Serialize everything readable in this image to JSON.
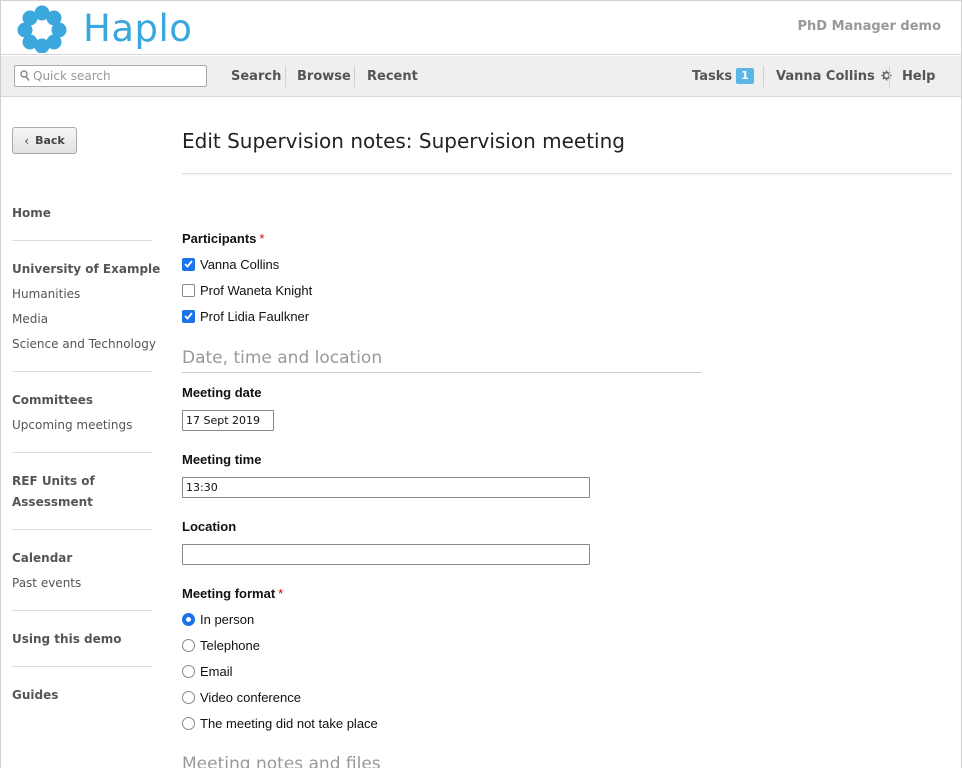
{
  "header": {
    "logo_text": "Haplo",
    "app_name": "PhD Manager demo",
    "logo_color": "#3aa7dd"
  },
  "navbar": {
    "search_placeholder": "Quick search",
    "search_value": "",
    "search": "Search",
    "browse": "Browse",
    "recent": "Recent",
    "tasks": "Tasks",
    "tasks_count": "1",
    "user": "Vanna Collins",
    "help": "Help"
  },
  "sidebar": {
    "back": "Back",
    "home": "Home",
    "university": "University of Example",
    "humanities": "Humanities",
    "media": "Media",
    "science": "Science and Technology",
    "committees": "Committees",
    "upcoming": "Upcoming meetings",
    "ref_line1": "REF Units of",
    "ref_line2": "Assessment",
    "calendar": "Calendar",
    "past_events": "Past events",
    "using_demo": "Using this demo",
    "guides": "Guides"
  },
  "main": {
    "title": "Edit Supervision notes: Supervision meeting",
    "participants_label": "Participants",
    "required_mark": "*",
    "participants": [
      {
        "label": "Vanna Collins",
        "checked": true
      },
      {
        "label": "Prof Waneta Knight",
        "checked": false
      },
      {
        "label": "Prof Lidia Faulkner",
        "checked": true
      }
    ],
    "section_date": "Date, time and location",
    "meeting_date_label": "Meeting date",
    "meeting_date_value": "17 Sept 2019",
    "meeting_time_label": "Meeting time",
    "meeting_time_value": "13:30",
    "location_label": "Location",
    "location_value": "",
    "meeting_format_label": "Meeting format",
    "formats": [
      {
        "label": "In person",
        "selected": true
      },
      {
        "label": "Telephone",
        "selected": false
      },
      {
        "label": "Email",
        "selected": false
      },
      {
        "label": "Video conference",
        "selected": false
      },
      {
        "label": "The meeting did not take place",
        "selected": false
      }
    ],
    "section_notes": "Meeting notes and files"
  },
  "colors": {
    "accent": "#1a73e8",
    "badge": "#5bb8e6",
    "required": "#cc0000"
  }
}
